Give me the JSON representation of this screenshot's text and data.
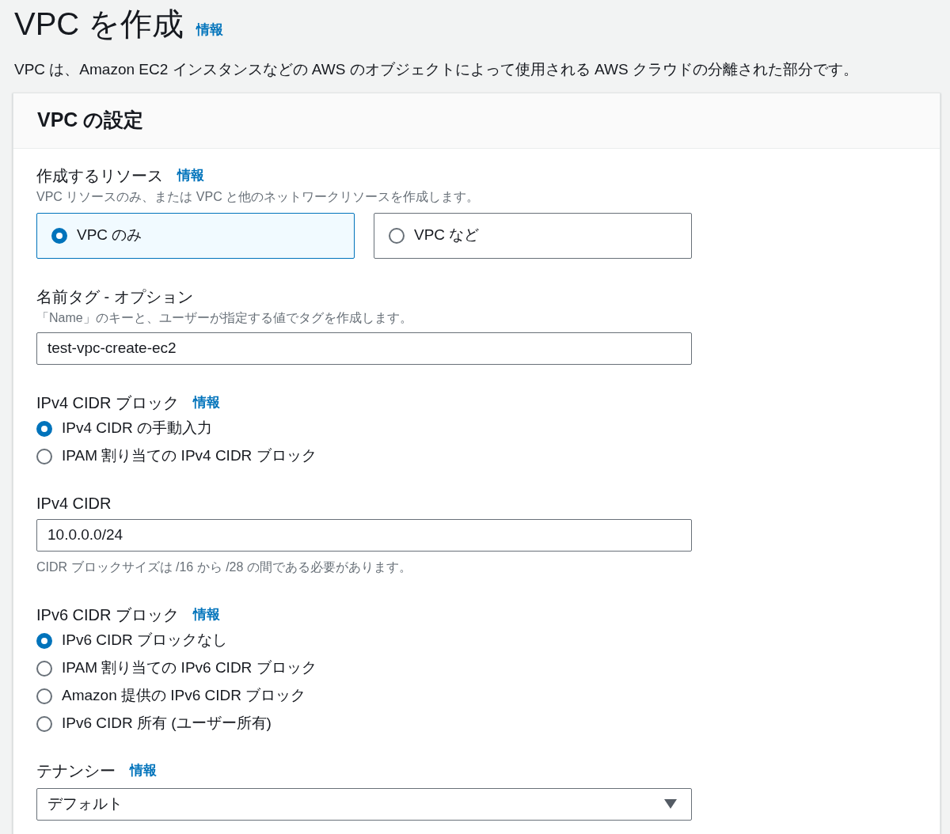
{
  "page": {
    "title": "VPC を作成",
    "info": "情報",
    "description": "VPC は、Amazon EC2 インスタンスなどの AWS のオブジェクトによって使用される AWS クラウドの分離された部分です。"
  },
  "panel": {
    "title": "VPC の設定",
    "sections": [
      {
        "kind": "tiles",
        "label": "作成するリソース",
        "info": "情報",
        "description": "VPC リソースのみ、または VPC と他のネットワークリソースを作成します。",
        "options": [
          {
            "label": "VPC のみ",
            "selected": true
          },
          {
            "label": "VPC など",
            "selected": false
          }
        ]
      },
      {
        "kind": "input",
        "label": "名前タグ - オプション",
        "description": "「Name」のキーと、ユーザーが指定する値でタグを作成します。",
        "value": "test-vpc-create-ec2"
      },
      {
        "kind": "radios",
        "label": "IPv4 CIDR ブロック",
        "info": "情報",
        "options": [
          {
            "label": "IPv4 CIDR の手動入力",
            "selected": true
          },
          {
            "label": "IPAM 割り当ての IPv4 CIDR ブロック",
            "selected": false
          }
        ]
      },
      {
        "kind": "input",
        "label": "IPv4 CIDR",
        "value": "10.0.0.0/24",
        "constraint": "CIDR ブロックサイズは /16 から /28 の間である必要があります。"
      },
      {
        "kind": "radios",
        "label": "IPv6 CIDR ブロック",
        "info": "情報",
        "options": [
          {
            "label": "IPv6 CIDR ブロックなし",
            "selected": true
          },
          {
            "label": "IPAM 割り当ての IPv6 CIDR ブロック",
            "selected": false
          },
          {
            "label": "Amazon 提供の IPv6 CIDR ブロック",
            "selected": false
          },
          {
            "label": "IPv6 CIDR 所有 (ユーザー所有)",
            "selected": false
          }
        ]
      },
      {
        "kind": "select",
        "label": "テナンシー",
        "info": "情報",
        "value": "デフォルト"
      }
    ]
  }
}
